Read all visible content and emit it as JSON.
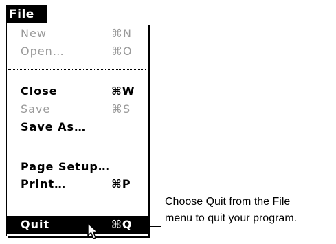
{
  "menu": {
    "title": "File",
    "items": [
      {
        "label": "New",
        "shortcut": "⌘N",
        "enabled": false
      },
      {
        "label": "Open…",
        "shortcut": "⌘O",
        "enabled": false
      },
      {
        "label": "Close",
        "shortcut": "⌘W",
        "enabled": true
      },
      {
        "label": "Save",
        "shortcut": "⌘S",
        "enabled": false
      },
      {
        "label": "Save As…",
        "shortcut": "",
        "enabled": true
      },
      {
        "label": "Page Setup…",
        "shortcut": "",
        "enabled": true
      },
      {
        "label": "Print…",
        "shortcut": "⌘P",
        "enabled": true
      },
      {
        "label": "Quit",
        "shortcut": "⌘Q",
        "enabled": true,
        "highlighted": true
      }
    ]
  },
  "callout": {
    "line1": "Choose Quit from the File",
    "line2": "menu to quit your program."
  },
  "cursor": {
    "icon": "arrow-pointer-icon"
  }
}
